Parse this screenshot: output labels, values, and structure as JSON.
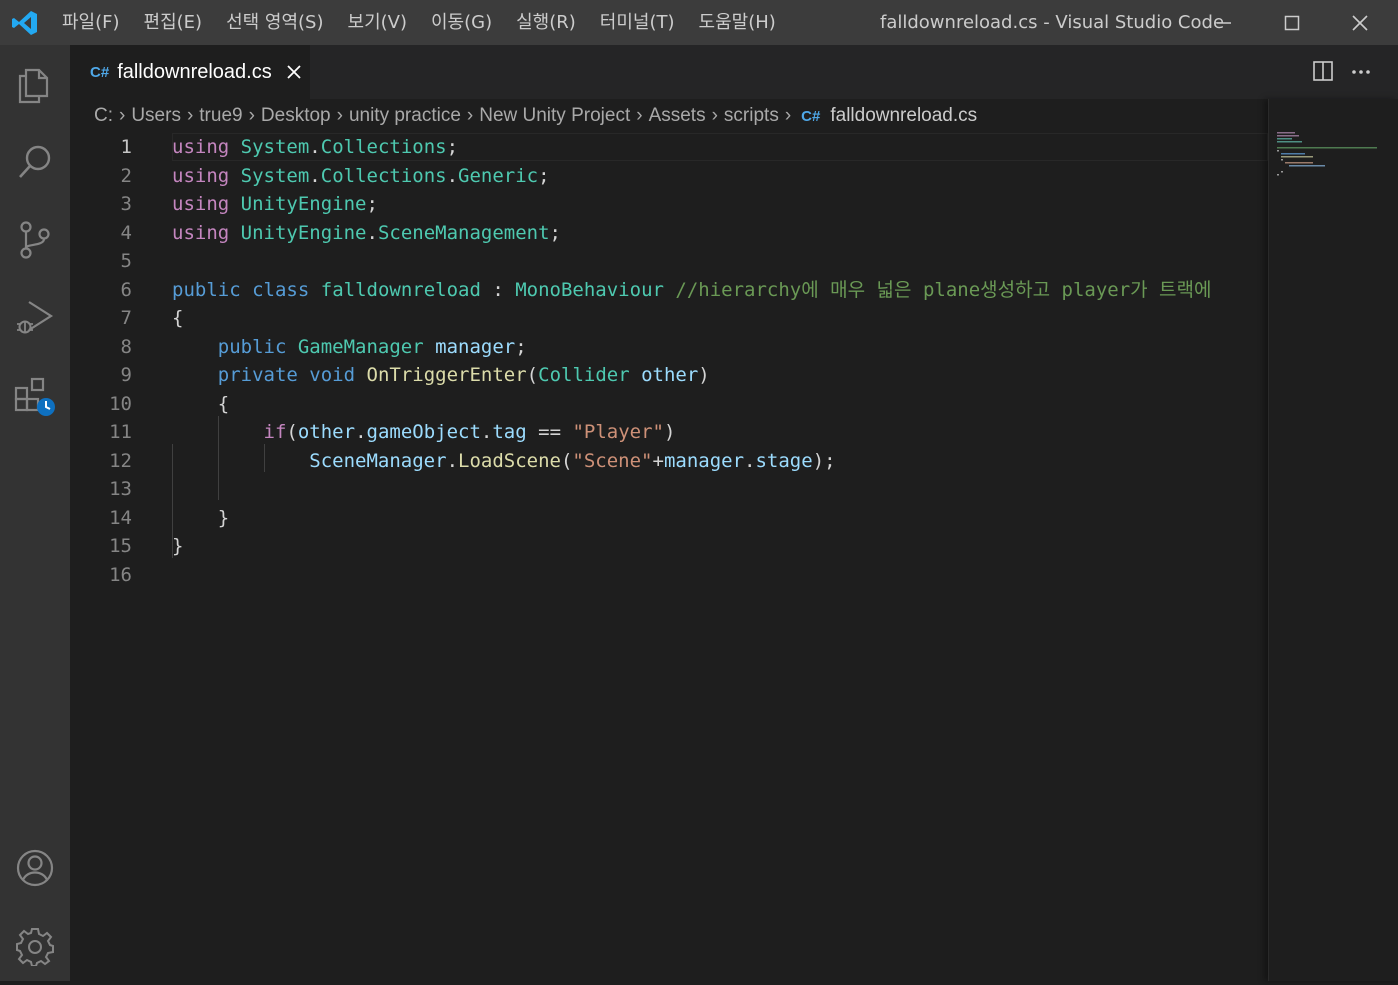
{
  "titlebar": {
    "menus": [
      "파일(F)",
      "편집(E)",
      "선택 영역(S)",
      "보기(V)",
      "이동(G)",
      "실행(R)",
      "터미널(T)",
      "도움말(H)"
    ],
    "window_title": "falldownreload.cs - Visual Studio Code"
  },
  "tab": {
    "label": "falldownreload.cs",
    "icon": "csharp-icon"
  },
  "breadcrumb": [
    "C:",
    "Users",
    "true9",
    "Desktop",
    "unity practice",
    "New Unity Project",
    "Assets",
    "scripts",
    "falldownreload.cs"
  ],
  "activity_icons": [
    "explorer-icon",
    "search-icon",
    "source-control-icon",
    "run-debug-icon",
    "extensions-icon",
    "accounts-icon",
    "settings-gear-icon"
  ],
  "editor": {
    "line_numbers": [
      "1",
      "2",
      "3",
      "4",
      "5",
      "6",
      "7",
      "8",
      "9",
      "10",
      "11",
      "12",
      "13",
      "14",
      "15",
      "16"
    ],
    "lines": [
      {
        "t": [
          [
            "kw",
            "using"
          ],
          [
            "pl",
            " "
          ],
          [
            "ns",
            "System"
          ],
          [
            "pl",
            "."
          ],
          [
            "ns",
            "Collections"
          ],
          [
            "pl",
            ";"
          ]
        ]
      },
      {
        "t": [
          [
            "kw",
            "using"
          ],
          [
            "pl",
            " "
          ],
          [
            "ns",
            "System"
          ],
          [
            "pl",
            "."
          ],
          [
            "ns",
            "Collections"
          ],
          [
            "pl",
            "."
          ],
          [
            "ns",
            "Generic"
          ],
          [
            "pl",
            ";"
          ]
        ]
      },
      {
        "t": [
          [
            "kw",
            "using"
          ],
          [
            "pl",
            " "
          ],
          [
            "ns",
            "UnityEngine"
          ],
          [
            "pl",
            ";"
          ]
        ]
      },
      {
        "t": [
          [
            "kw",
            "using"
          ],
          [
            "pl",
            " "
          ],
          [
            "ns",
            "UnityEngine"
          ],
          [
            "pl",
            "."
          ],
          [
            "ns",
            "SceneManagement"
          ],
          [
            "pl",
            ";"
          ]
        ]
      },
      {
        "t": []
      },
      {
        "t": [
          [
            "kw2",
            "public"
          ],
          [
            "pl",
            " "
          ],
          [
            "kw2",
            "class"
          ],
          [
            "pl",
            " "
          ],
          [
            "ns",
            "falldownreload"
          ],
          [
            "pl",
            " : "
          ],
          [
            "ns",
            "MonoBehaviour"
          ],
          [
            "pl",
            " "
          ],
          [
            "cmt",
            "//hierarchy에 매우 넓은 plane생성하고 player가 트랙에"
          ]
        ]
      },
      {
        "t": [
          [
            "pl",
            "{"
          ]
        ]
      },
      {
        "t": [
          [
            "pl",
            "    "
          ],
          [
            "kw2",
            "public"
          ],
          [
            "pl",
            " "
          ],
          [
            "ns",
            "GameManager"
          ],
          [
            "pl",
            " "
          ],
          [
            "var",
            "manager"
          ],
          [
            "pl",
            ";"
          ]
        ]
      },
      {
        "t": [
          [
            "pl",
            "    "
          ],
          [
            "kw2",
            "private"
          ],
          [
            "pl",
            " "
          ],
          [
            "kw2",
            "void"
          ],
          [
            "pl",
            " "
          ],
          [
            "fn",
            "OnTriggerEnter"
          ],
          [
            "pl",
            "("
          ],
          [
            "ns",
            "Collider"
          ],
          [
            "pl",
            " "
          ],
          [
            "var",
            "other"
          ],
          [
            "pl",
            ")"
          ]
        ]
      },
      {
        "t": [
          [
            "pl",
            "    {"
          ]
        ]
      },
      {
        "t": [
          [
            "pl",
            "        "
          ],
          [
            "kw",
            "if"
          ],
          [
            "pl",
            "("
          ],
          [
            "var",
            "other"
          ],
          [
            "pl",
            "."
          ],
          [
            "var",
            "gameObject"
          ],
          [
            "pl",
            "."
          ],
          [
            "var",
            "tag"
          ],
          [
            "pl",
            " == "
          ],
          [
            "str",
            "\"Player\""
          ],
          [
            "pl",
            ")"
          ]
        ]
      },
      {
        "t": [
          [
            "pl",
            "            "
          ],
          [
            "var",
            "SceneManager"
          ],
          [
            "pl",
            "."
          ],
          [
            "fn",
            "LoadScene"
          ],
          [
            "pl",
            "("
          ],
          [
            "str",
            "\"Scene\""
          ],
          [
            "pl",
            "+"
          ],
          [
            "var",
            "manager"
          ],
          [
            "pl",
            "."
          ],
          [
            "var",
            "stage"
          ],
          [
            "pl",
            ");"
          ]
        ]
      },
      {
        "t": []
      },
      {
        "t": [
          [
            "pl",
            "    }"
          ]
        ]
      },
      {
        "t": [
          [
            "pl",
            "}"
          ]
        ]
      },
      {
        "t": []
      }
    ]
  }
}
